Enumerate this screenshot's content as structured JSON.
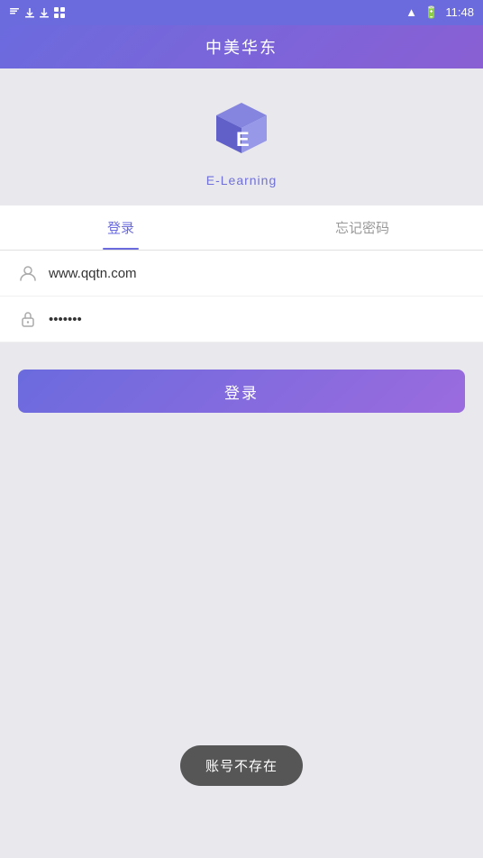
{
  "statusBar": {
    "time": "11:48"
  },
  "topBar": {
    "title": "中美华东"
  },
  "logo": {
    "altText": "E-Learning",
    "label": "E-Learning"
  },
  "tabs": [
    {
      "id": "login",
      "label": "登录",
      "active": true
    },
    {
      "id": "forgot",
      "label": "忘记密码",
      "active": false
    }
  ],
  "form": {
    "usernamePlaceholder": "www.qqtn.com",
    "usernameValue": "www.qqtn.com",
    "passwordPlaceholder": "••••••••",
    "passwordValue": "•••••••"
  },
  "loginButton": {
    "label": "登录"
  },
  "toast": {
    "message": "账号不存在"
  }
}
